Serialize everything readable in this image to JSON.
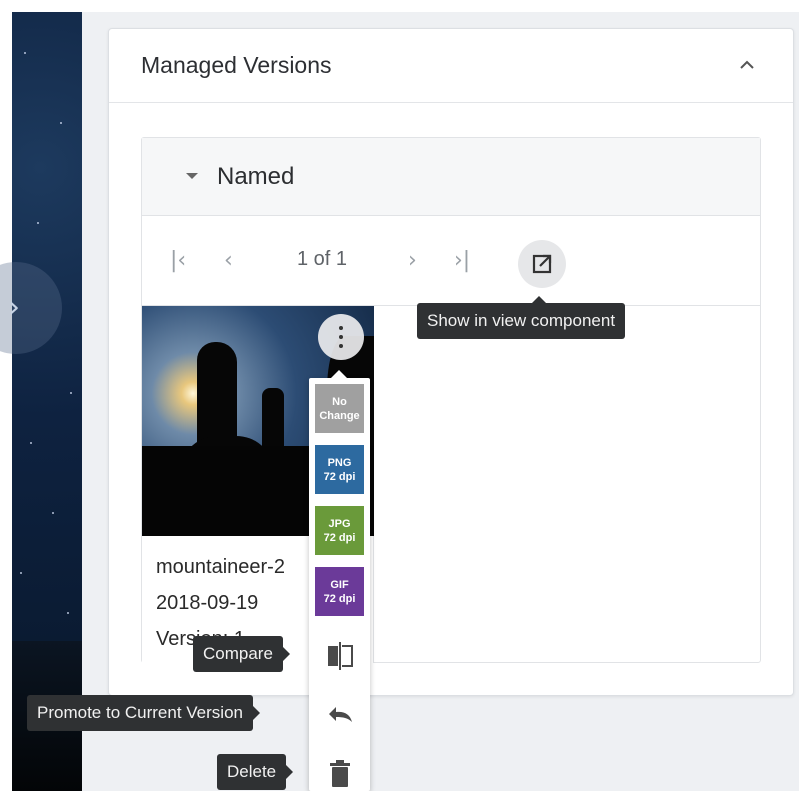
{
  "panel": {
    "title": "Managed Versions",
    "collapse_icon": "chevron-up-icon"
  },
  "section": {
    "title": "Named",
    "toggle_icon": "caret-down-icon"
  },
  "pager": {
    "first_icon": "first-page-icon",
    "prev_icon": "prev-page-icon",
    "page_text": "1 of 1",
    "next_icon": "next-page-icon",
    "last_icon": "last-page-icon",
    "open_view_icon": "open-in-new-icon",
    "open_view_tooltip": "Show in view component"
  },
  "version_card": {
    "name": "mountaineer-2",
    "date": "2018-09-19",
    "version": "Version: 1",
    "menu_icon": "more-vert-icon"
  },
  "menu": {
    "formats": [
      {
        "line1": "No",
        "line2": "Change",
        "color": "#a0a0a0"
      },
      {
        "line1": "PNG",
        "line2": "72 dpi",
        "color": "#2d6aa0"
      },
      {
        "line1": "JPG",
        "line2": "72 dpi",
        "color": "#6a9a3a"
      },
      {
        "line1": "GIF",
        "line2": "72 dpi",
        "color": "#6b3a99"
      }
    ],
    "compare_tooltip": "Compare",
    "promote_tooltip": "Promote to Current Version",
    "delete_tooltip": "Delete",
    "compare_icon": "compare-icon",
    "promote_icon": "undo-icon",
    "delete_icon": "trash-icon"
  }
}
